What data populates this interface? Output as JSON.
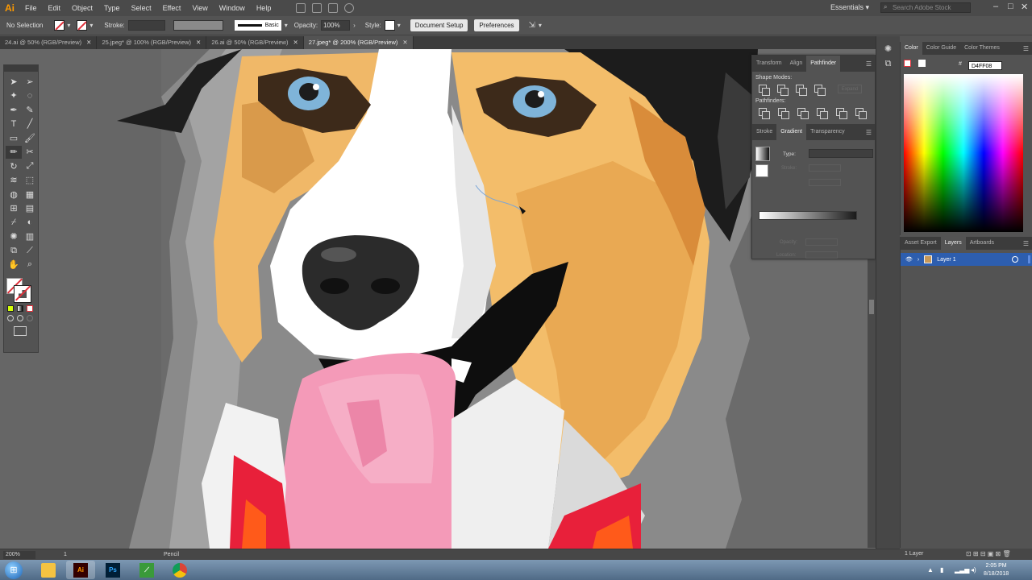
{
  "app": {
    "logo": "Ai",
    "menus": [
      "File",
      "Edit",
      "Object",
      "Type",
      "Select",
      "Effect",
      "View",
      "Window",
      "Help"
    ],
    "workspace": "Essentials",
    "stock_search_placeholder": "Search Adobe Stock"
  },
  "controlbar": {
    "selection": "No Selection",
    "stroke_label": "Stroke:",
    "brush": "Basic",
    "opacity_label": "Opacity:",
    "opacity_value": "100%",
    "style_label": "Style:",
    "document_setup": "Document Setup",
    "preferences": "Preferences"
  },
  "tabs": [
    {
      "label": "24.ai @ 50% (RGB/Preview)",
      "active": false
    },
    {
      "label": "25.jpeg* @ 100% (RGB/Preview)",
      "active": false
    },
    {
      "label": "26.ai @ 50% (RGB/Preview)",
      "active": false
    },
    {
      "label": "27.jpeg* @ 200% (RGB/Preview)",
      "active": true
    }
  ],
  "pathfinder_panel": {
    "tabs": [
      "Transform",
      "Align",
      "Pathfinder"
    ],
    "shape_modes_label": "Shape Modes:",
    "expand_label": "Expand",
    "pathfinders_label": "Pathfinders:"
  },
  "gradient_panel": {
    "tabs": [
      "Stroke",
      "Gradient",
      "Transparency"
    ],
    "type_label": "Type:",
    "stroke_label": "Stroke:",
    "opacity_label": "Opacity:",
    "location_label": "Location:"
  },
  "color_panel": {
    "tabs": [
      "Color",
      "Color Guide",
      "Color Themes"
    ],
    "hex_value": "D4FF08"
  },
  "layers_panel": {
    "tabs": [
      "Asset Export",
      "Layers",
      "Artboards"
    ],
    "layer_name": "Layer 1",
    "footer": "1 Layer"
  },
  "statusbar": {
    "zoom": "200%",
    "artboard": "1",
    "tool": "Pencil"
  },
  "taskbar": {
    "time": "2:05 PM",
    "date": "8/18/2018",
    "apps": [
      "Explorer",
      "Ai",
      "Ps",
      "Edge Animate",
      "Chrome"
    ]
  },
  "colors": {
    "accent": "#2d5eaf",
    "ai_orange": "#ff9a00",
    "tongue": "#f49ab8",
    "fur_tan": "#f0b868",
    "bandana": "#e8203a"
  }
}
